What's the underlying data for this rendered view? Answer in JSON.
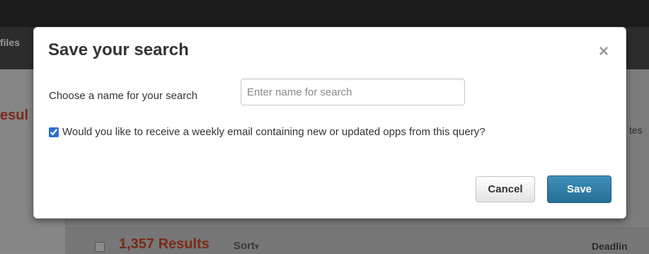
{
  "background": {
    "nav_fragment": "files",
    "results_fragment": "esul",
    "right_fragment": "tes",
    "results_count": "1,357 Results",
    "sort_label": "Sort",
    "sort_caret": "▾",
    "deadline_fragment": "Deadlin"
  },
  "modal": {
    "title": "Save your search",
    "close_glyph": "×",
    "name_label": "Choose a name for your search",
    "name_input": {
      "value": "",
      "placeholder": "Enter name for search"
    },
    "email_option": {
      "checked": true,
      "label": "Would you like to receive a weekly email containing new or updated opps from this query?"
    },
    "cancel_label": "Cancel",
    "save_label": "Save"
  },
  "colors": {
    "save_button": "#2b7ba3",
    "results_text": "#7b2a1a"
  }
}
